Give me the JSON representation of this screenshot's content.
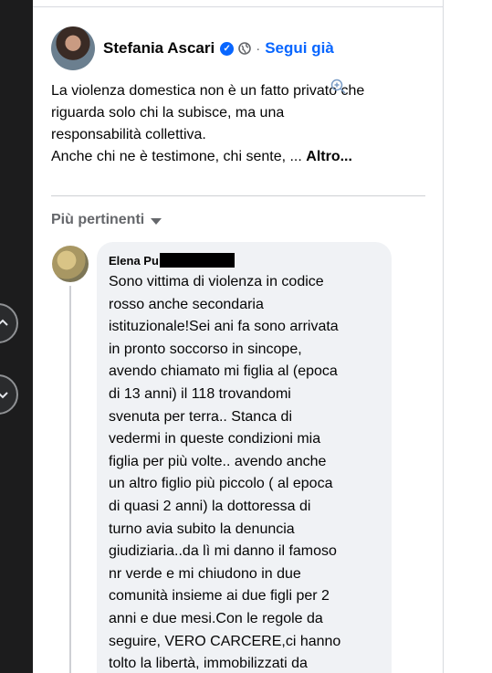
{
  "post": {
    "author": "Stefania Ascari",
    "separator": "·",
    "follow_label": "Segui già",
    "text_lines": [
      "La violenza domestica non è un fatto privato che",
      "riguarda solo chi la subisce, ma una",
      "responsabilità collettiva.",
      "Anche chi ne è testimone, chi sente, ..."
    ],
    "more_label": "Altro..."
  },
  "comments_filter": {
    "label": "Più pertinenti"
  },
  "comment": {
    "author": "Elena Pu",
    "lines": [
      "Sono vittima di violenza in codice",
      "rosso anche secondaria",
      "istituzionale!Sei ani fa sono arrivata",
      "in pronto soccorso in sincope,",
      "avendo chiamato mi figlia al (epoca",
      "di 13 anni) il 118 trovandomi",
      "svenuta per terra.. Stanca di",
      "vedermi in queste condizioni mia",
      "figlia per più volte.. avendo anche",
      "un altro figlio più piccolo ( al epoca",
      "di quasi 2 anni) la dottoressa di",
      "turno avia subito la denuncia",
      "giudiziaria..da lì mi danno il famoso",
      "nr verde e mi chiudono in due",
      "comunità insieme ai due figli per 2",
      "anni e due mesi.Con le regole da",
      "seguire, VERO CARCERE,ci hanno",
      "tolto la libertà, immobilizzati da"
    ]
  },
  "icons": {
    "verified": "verified-badge-icon",
    "globe": "globe-icon",
    "caret": "caret-down-icon",
    "zoom": "zoom-in-icon",
    "nav_up": "chevron-up-icon",
    "nav_down": "chevron-down-icon"
  },
  "colors": {
    "link_blue": "#0866ff",
    "bubble_bg": "#f0f2f5",
    "muted_text": "#65676b"
  }
}
